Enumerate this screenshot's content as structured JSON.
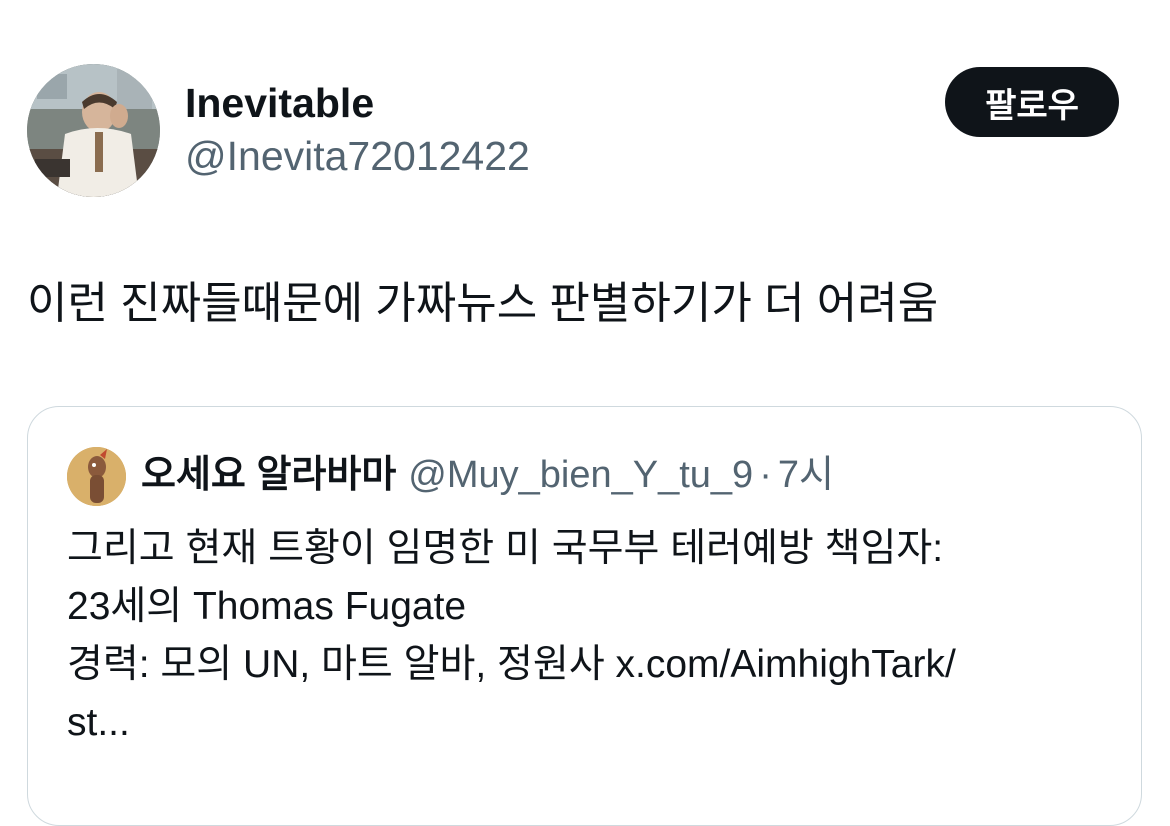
{
  "tweet": {
    "author": {
      "display_name": "Inevitable",
      "handle": "@Inevita72012422",
      "avatar_icon": "user-avatar-photo"
    },
    "follow_label": "팔로우",
    "text": "이런 진짜들때문에 가짜뉴스 판별하기가 더 어려움"
  },
  "quote": {
    "author": {
      "display_name": "오세요 알라바마",
      "handle": "@Muy_bien_Y_tu_9",
      "avatar_icon": "user-avatar-illustration"
    },
    "separator": "·",
    "time": "7시",
    "lines": [
      "그리고 현재 트황이 임명한 미 국무부 테러예방 책임자:",
      "23세의 Thomas Fugate",
      "경력: 모의 UN, 마트 알바, 정원사 x.com/AimhighTark/",
      "st..."
    ]
  },
  "colors": {
    "text_primary": "#0f1419",
    "text_secondary": "#536471",
    "button_bg": "#0f1419",
    "card_border": "#cfd9de"
  }
}
